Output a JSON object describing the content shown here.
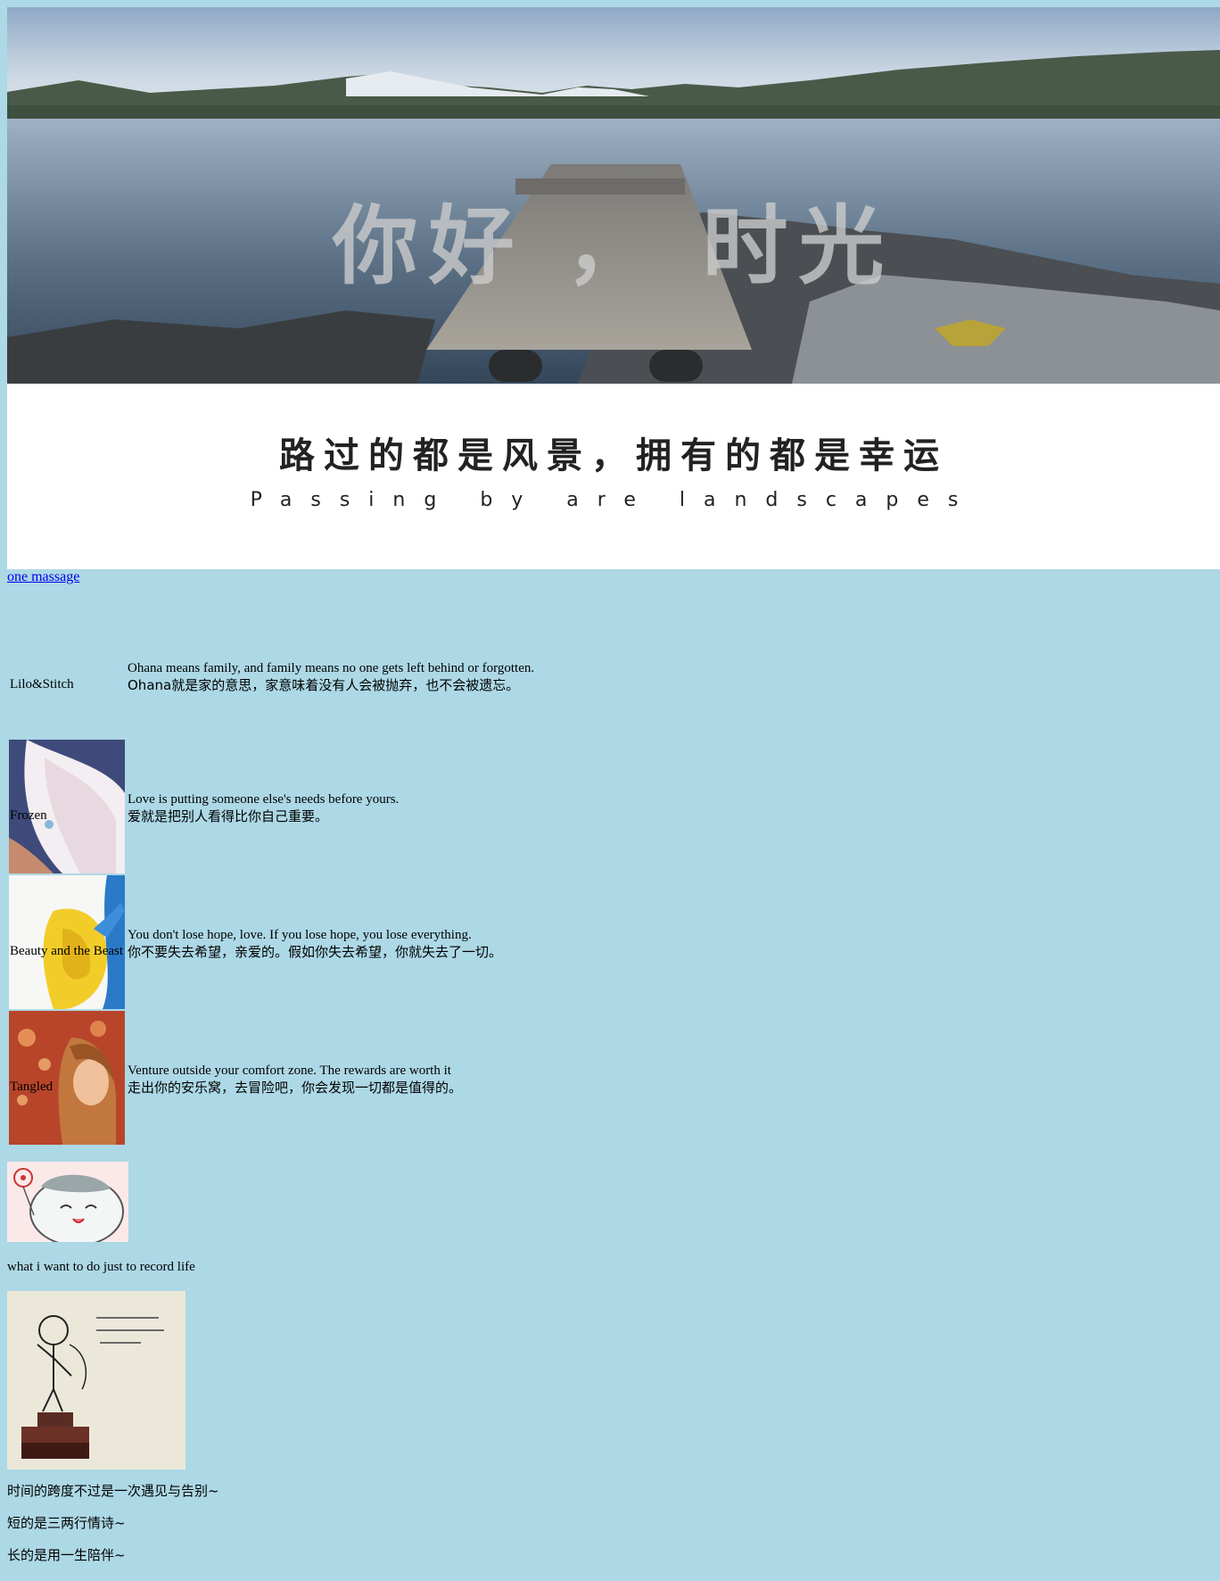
{
  "banner": {
    "title": "你好 ， 时光",
    "slogan": "路过的都是风景，拥有的都是幸运",
    "subslogan": "Passing by are landscapes"
  },
  "link": {
    "label": "one massage"
  },
  "quotes": [
    {
      "name": "Lilo&Stitch",
      "en": "Ohana means family, and family means no one gets left behind or forgotten.",
      "zh": "Ohana就是家的意思，家意味着没有人会被抛弃，也不会被遗忘。"
    },
    {
      "name": "Frozen",
      "en": "Love is putting someone else's needs before yours.",
      "zh": "爱就是把别人看得比你自己重要。"
    },
    {
      "name": "Beauty and the Beast",
      "en": "You don't lose hope, love. If you lose hope, you lose everything.",
      "zh": "你不要失去希望，亲爱的。假如你失去希望，你就失去了一切。"
    },
    {
      "name": "Tangled",
      "en": "Venture outside your comfort zone. The rewards are worth it",
      "zh": "走出你的安乐窝，去冒险吧，你会发现一切都是值得的。"
    }
  ],
  "record_text": "what i want to do just to record life",
  "poem": [
    "时间的跨度不过是一次遇见与告别~",
    "短的是三两行情诗~",
    "长的是用一生陪伴~"
  ],
  "colors": {
    "page_background": "#add8e6",
    "link": "#0000ee"
  }
}
